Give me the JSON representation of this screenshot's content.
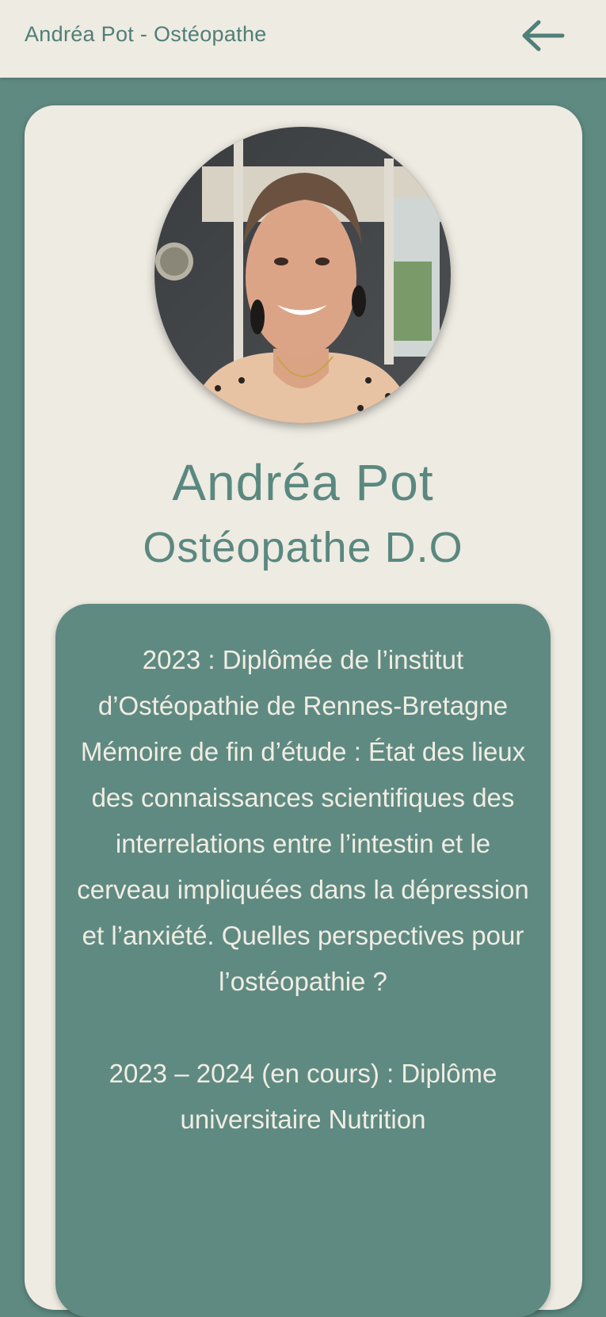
{
  "header": {
    "title": "Andréa Pot - Ostéopathe",
    "back_icon": "arrow-left-icon"
  },
  "profile": {
    "name": "Andréa Pot",
    "role": "Ostéopathe D.O"
  },
  "bio": {
    "paragraph_1": "2023 : Diplômée de l’institut d’Ostéopathie de Rennes-Bretagne",
    "paragraph_2": "Mémoire de fin d’étude : État des lieux des connaissances scientifiques des interrelations entre l’intestin et le cerveau impliquées dans la dépression et l’anxiété. Quelles perspectives pour l’ostéopathie ?",
    "paragraph_3": "2023 – 2024 (en cours) : Diplôme universitaire Nutrition"
  },
  "colors": {
    "accent": "#5f8a82",
    "background": "#eeebe2",
    "text_light": "#f1ede3"
  }
}
